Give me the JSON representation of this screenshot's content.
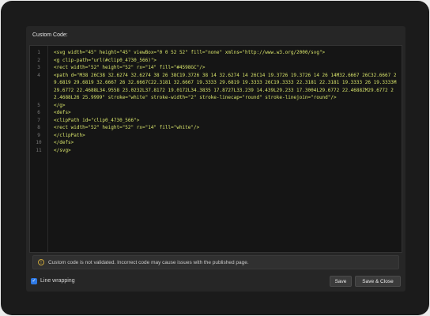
{
  "dialog": {
    "title": "Custom Code:",
    "warning_icon": "info-circle-icon",
    "warning": "Custom code is not validated. Incorrect code may cause issues with the published page.",
    "line_wrapping_label": "Line wrapping",
    "line_wrapping_checked": true,
    "save_label": "Save",
    "save_close_label": "Save & Close"
  },
  "code_lines": [
    {
      "n": "1",
      "text": "<svg width=\"45\" height=\"45\" viewBox=\"0 0 52 52\" fill=\"none\" xmlns=\"http://www.w3.org/2000/svg\">"
    },
    {
      "n": "2",
      "text": "<g clip-path=\"url(#clip0_4730_566)\">"
    },
    {
      "n": "3",
      "text": "<rect width=\"52\" height=\"52\" rx=\"14\" fill=\"#4598GC\"/>"
    },
    {
      "n": "4",
      "text": "<path d=\"M38 26C38 32.6274 32.6274 38 26 38C19.3726 38 14 32.6274 14 26C14 19.3726 19.3726 14 26 14M32.6667 26C32.6667 29.6819 29.6819 32.6667 26 32.6667C22.3181 32.6667 19.3333 29.6819 19.3333 26C19.3333 22.3181 22.3181 19.3333 26 19.3333M29.6772 22.4688L34.9558 23.0232L37.8172 19.0172L34.3835 17.8727L33.239 14.439L29.233 17.3004L29.6772 22.4688ZM29.6772 22.4688L26 25.9999\" stroke=\"white\" stroke-width=\"2\" stroke-linecap=\"round\" stroke-linejoin=\"round\"/>"
    },
    {
      "n": "5",
      "text": "</g>"
    },
    {
      "n": "6",
      "text": "<defs>"
    },
    {
      "n": "7",
      "text": "<clipPath id=\"clip0_4730_566\">"
    },
    {
      "n": "8",
      "text": "<rect width=\"52\" height=\"52\" rx=\"14\" fill=\"white\"/>"
    },
    {
      "n": "9",
      "text": "</clipPath>"
    },
    {
      "n": "10",
      "text": "</defs>"
    },
    {
      "n": "11",
      "text": "</svg>"
    }
  ]
}
